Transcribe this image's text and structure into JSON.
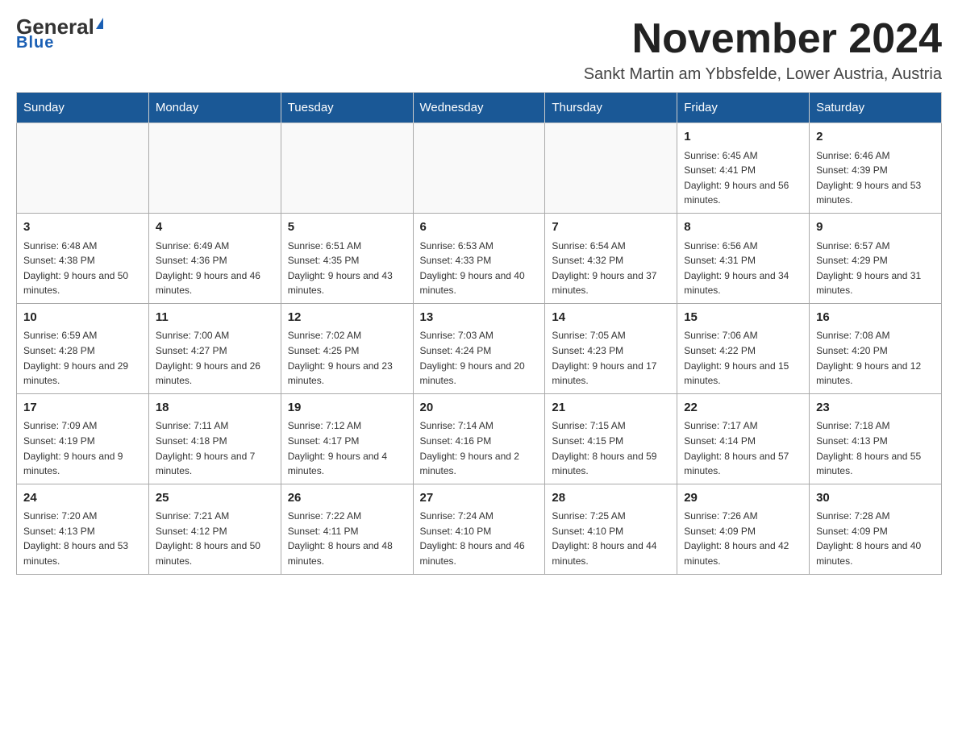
{
  "header": {
    "logo_general": "General",
    "logo_blue": "Blue",
    "main_title": "November 2024",
    "subtitle": "Sankt Martin am Ybbsfelde, Lower Austria, Austria"
  },
  "days_of_week": [
    "Sunday",
    "Monday",
    "Tuesday",
    "Wednesday",
    "Thursday",
    "Friday",
    "Saturday"
  ],
  "weeks": [
    [
      {
        "day": "",
        "info": ""
      },
      {
        "day": "",
        "info": ""
      },
      {
        "day": "",
        "info": ""
      },
      {
        "day": "",
        "info": ""
      },
      {
        "day": "",
        "info": ""
      },
      {
        "day": "1",
        "info": "Sunrise: 6:45 AM\nSunset: 4:41 PM\nDaylight: 9 hours and 56 minutes."
      },
      {
        "day": "2",
        "info": "Sunrise: 6:46 AM\nSunset: 4:39 PM\nDaylight: 9 hours and 53 minutes."
      }
    ],
    [
      {
        "day": "3",
        "info": "Sunrise: 6:48 AM\nSunset: 4:38 PM\nDaylight: 9 hours and 50 minutes."
      },
      {
        "day": "4",
        "info": "Sunrise: 6:49 AM\nSunset: 4:36 PM\nDaylight: 9 hours and 46 minutes."
      },
      {
        "day": "5",
        "info": "Sunrise: 6:51 AM\nSunset: 4:35 PM\nDaylight: 9 hours and 43 minutes."
      },
      {
        "day": "6",
        "info": "Sunrise: 6:53 AM\nSunset: 4:33 PM\nDaylight: 9 hours and 40 minutes."
      },
      {
        "day": "7",
        "info": "Sunrise: 6:54 AM\nSunset: 4:32 PM\nDaylight: 9 hours and 37 minutes."
      },
      {
        "day": "8",
        "info": "Sunrise: 6:56 AM\nSunset: 4:31 PM\nDaylight: 9 hours and 34 minutes."
      },
      {
        "day": "9",
        "info": "Sunrise: 6:57 AM\nSunset: 4:29 PM\nDaylight: 9 hours and 31 minutes."
      }
    ],
    [
      {
        "day": "10",
        "info": "Sunrise: 6:59 AM\nSunset: 4:28 PM\nDaylight: 9 hours and 29 minutes."
      },
      {
        "day": "11",
        "info": "Sunrise: 7:00 AM\nSunset: 4:27 PM\nDaylight: 9 hours and 26 minutes."
      },
      {
        "day": "12",
        "info": "Sunrise: 7:02 AM\nSunset: 4:25 PM\nDaylight: 9 hours and 23 minutes."
      },
      {
        "day": "13",
        "info": "Sunrise: 7:03 AM\nSunset: 4:24 PM\nDaylight: 9 hours and 20 minutes."
      },
      {
        "day": "14",
        "info": "Sunrise: 7:05 AM\nSunset: 4:23 PM\nDaylight: 9 hours and 17 minutes."
      },
      {
        "day": "15",
        "info": "Sunrise: 7:06 AM\nSunset: 4:22 PM\nDaylight: 9 hours and 15 minutes."
      },
      {
        "day": "16",
        "info": "Sunrise: 7:08 AM\nSunset: 4:20 PM\nDaylight: 9 hours and 12 minutes."
      }
    ],
    [
      {
        "day": "17",
        "info": "Sunrise: 7:09 AM\nSunset: 4:19 PM\nDaylight: 9 hours and 9 minutes."
      },
      {
        "day": "18",
        "info": "Sunrise: 7:11 AM\nSunset: 4:18 PM\nDaylight: 9 hours and 7 minutes."
      },
      {
        "day": "19",
        "info": "Sunrise: 7:12 AM\nSunset: 4:17 PM\nDaylight: 9 hours and 4 minutes."
      },
      {
        "day": "20",
        "info": "Sunrise: 7:14 AM\nSunset: 4:16 PM\nDaylight: 9 hours and 2 minutes."
      },
      {
        "day": "21",
        "info": "Sunrise: 7:15 AM\nSunset: 4:15 PM\nDaylight: 8 hours and 59 minutes."
      },
      {
        "day": "22",
        "info": "Sunrise: 7:17 AM\nSunset: 4:14 PM\nDaylight: 8 hours and 57 minutes."
      },
      {
        "day": "23",
        "info": "Sunrise: 7:18 AM\nSunset: 4:13 PM\nDaylight: 8 hours and 55 minutes."
      }
    ],
    [
      {
        "day": "24",
        "info": "Sunrise: 7:20 AM\nSunset: 4:13 PM\nDaylight: 8 hours and 53 minutes."
      },
      {
        "day": "25",
        "info": "Sunrise: 7:21 AM\nSunset: 4:12 PM\nDaylight: 8 hours and 50 minutes."
      },
      {
        "day": "26",
        "info": "Sunrise: 7:22 AM\nSunset: 4:11 PM\nDaylight: 8 hours and 48 minutes."
      },
      {
        "day": "27",
        "info": "Sunrise: 7:24 AM\nSunset: 4:10 PM\nDaylight: 8 hours and 46 minutes."
      },
      {
        "day": "28",
        "info": "Sunrise: 7:25 AM\nSunset: 4:10 PM\nDaylight: 8 hours and 44 minutes."
      },
      {
        "day": "29",
        "info": "Sunrise: 7:26 AM\nSunset: 4:09 PM\nDaylight: 8 hours and 42 minutes."
      },
      {
        "day": "30",
        "info": "Sunrise: 7:28 AM\nSunset: 4:09 PM\nDaylight: 8 hours and 40 minutes."
      }
    ]
  ]
}
